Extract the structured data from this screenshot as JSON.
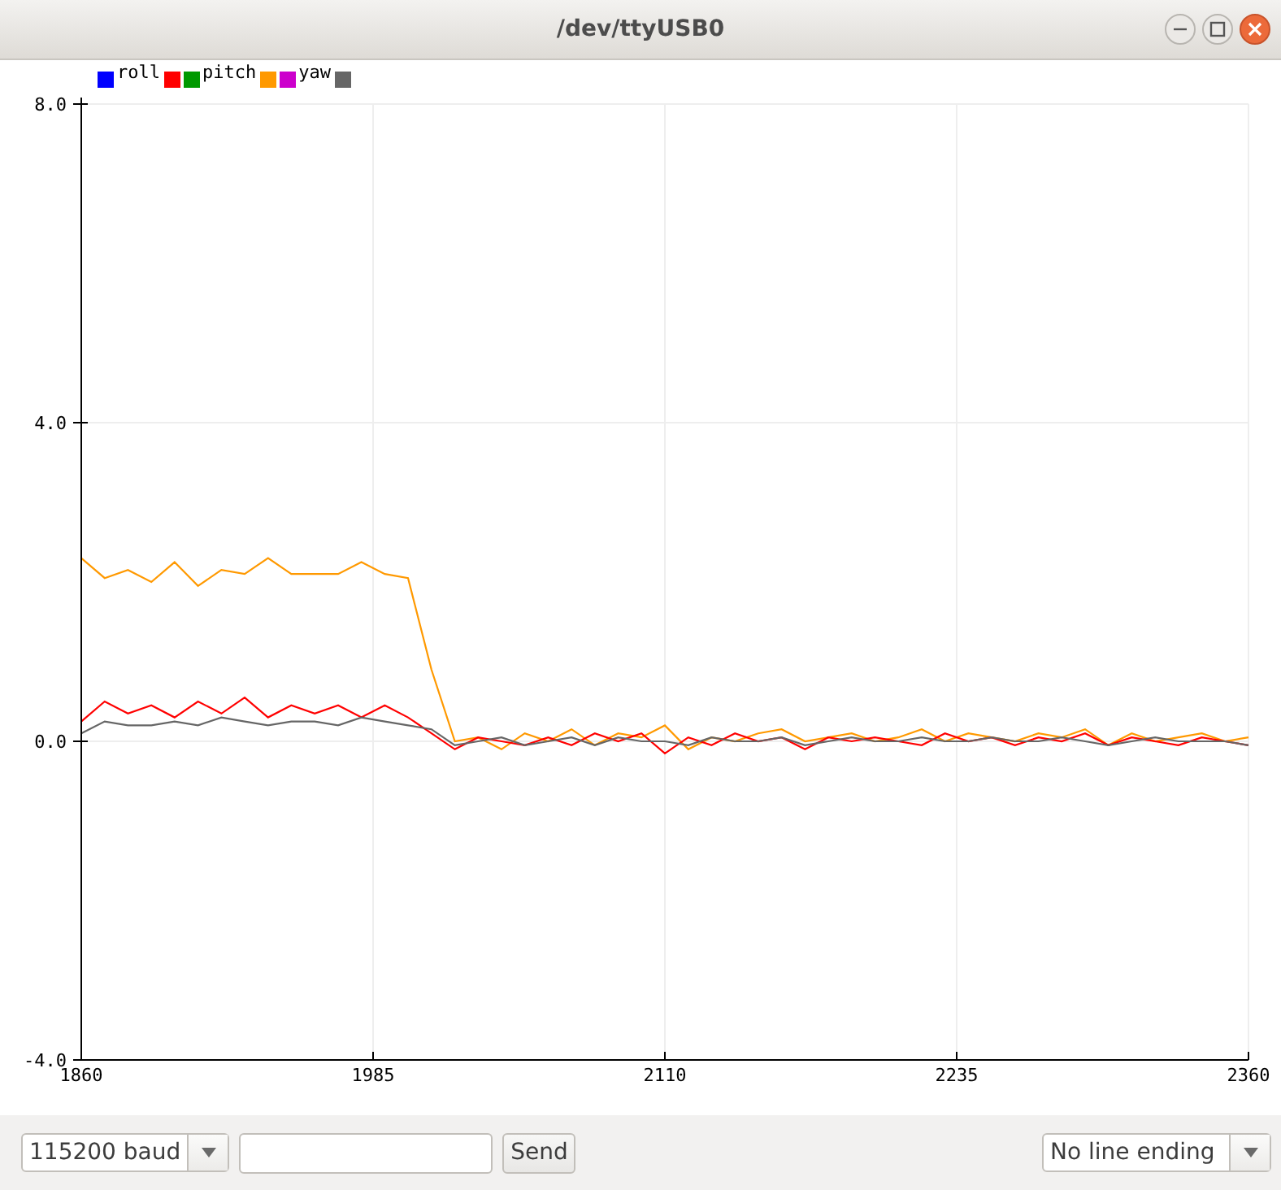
{
  "window": {
    "title": "/dev/ttyUSB0"
  },
  "legend": [
    {
      "color": "#0000ff",
      "label": "roll"
    },
    {
      "color": "#ff0000"
    },
    {
      "color": "#009900",
      "label": "pitch"
    },
    {
      "color": "#ff9900"
    },
    {
      "color": "#cc00cc",
      "label": "yaw"
    },
    {
      "color": "#666666"
    }
  ],
  "plot": {
    "chart_data": {
      "type": "line",
      "grid": true,
      "xlim": [
        1860,
        2360
      ],
      "ylim": [
        -4,
        8
      ],
      "xticks": [
        1860,
        1985,
        2110,
        2235,
        2360
      ],
      "yticks": [
        {
          "value": -4,
          "label": "-4.0"
        },
        {
          "value": 0,
          "label": "0.0"
        },
        {
          "value": 4,
          "label": "4.0"
        },
        {
          "value": 8,
          "label": "8.0"
        }
      ],
      "x": [
        1860,
        1870,
        1880,
        1890,
        1900,
        1910,
        1920,
        1930,
        1940,
        1950,
        1960,
        1970,
        1980,
        1990,
        2000,
        2010,
        2020,
        2030,
        2040,
        2050,
        2060,
        2070,
        2080,
        2090,
        2100,
        2110,
        2120,
        2130,
        2140,
        2150,
        2160,
        2170,
        2180,
        2190,
        2200,
        2210,
        2220,
        2230,
        2240,
        2250,
        2260,
        2270,
        2280,
        2290,
        2300,
        2310,
        2320,
        2330,
        2340,
        2350,
        2360
      ],
      "series": [
        {
          "color": "#ff9900",
          "values": [
            2.3,
            2.05,
            2.15,
            2.0,
            2.25,
            1.95,
            2.15,
            2.1,
            2.3,
            2.1,
            2.1,
            2.1,
            2.25,
            2.1,
            2.05,
            0.9,
            0.0,
            0.05,
            -0.1,
            0.1,
            0.0,
            0.15,
            -0.05,
            0.1,
            0.05,
            0.2,
            -0.1,
            0.05,
            0.0,
            0.1,
            0.15,
            0.0,
            0.05,
            0.1,
            0.0,
            0.05,
            0.15,
            0.0,
            0.1,
            0.05,
            0.0,
            0.1,
            0.05,
            0.15,
            -0.05,
            0.1,
            0.0,
            0.05,
            0.1,
            0.0,
            0.05
          ]
        },
        {
          "color": "#ff0000",
          "values": [
            0.25,
            0.5,
            0.35,
            0.45,
            0.3,
            0.5,
            0.35,
            0.55,
            0.3,
            0.45,
            0.35,
            0.45,
            0.3,
            0.45,
            0.3,
            0.1,
            -0.1,
            0.05,
            0.0,
            -0.05,
            0.05,
            -0.05,
            0.1,
            0.0,
            0.1,
            -0.15,
            0.05,
            -0.05,
            0.1,
            0.0,
            0.05,
            -0.1,
            0.05,
            0.0,
            0.05,
            0.0,
            -0.05,
            0.1,
            0.0,
            0.05,
            -0.05,
            0.05,
            0.0,
            0.1,
            -0.05,
            0.05,
            0.0,
            -0.05,
            0.05,
            0.0,
            -0.05
          ]
        },
        {
          "color": "#666666",
          "values": [
            0.1,
            0.25,
            0.2,
            0.2,
            0.25,
            0.2,
            0.3,
            0.25,
            0.2,
            0.25,
            0.25,
            0.2,
            0.3,
            0.25,
            0.2,
            0.15,
            -0.05,
            0.0,
            0.05,
            -0.05,
            0.0,
            0.05,
            -0.05,
            0.05,
            0.0,
            0.0,
            -0.05,
            0.05,
            0.0,
            0.0,
            0.05,
            -0.05,
            0.0,
            0.05,
            0.0,
            0.0,
            0.05,
            0.0,
            0.0,
            0.05,
            0.0,
            0.0,
            0.05,
            0.0,
            -0.05,
            0.0,
            0.05,
            0.0,
            0.0,
            0.0,
            -0.05
          ]
        }
      ]
    }
  },
  "bottom_bar": {
    "baud_select": {
      "value": "115200 baud"
    },
    "send_button": {
      "label": "Send"
    },
    "line_ending_select": {
      "value": "No line ending"
    }
  }
}
